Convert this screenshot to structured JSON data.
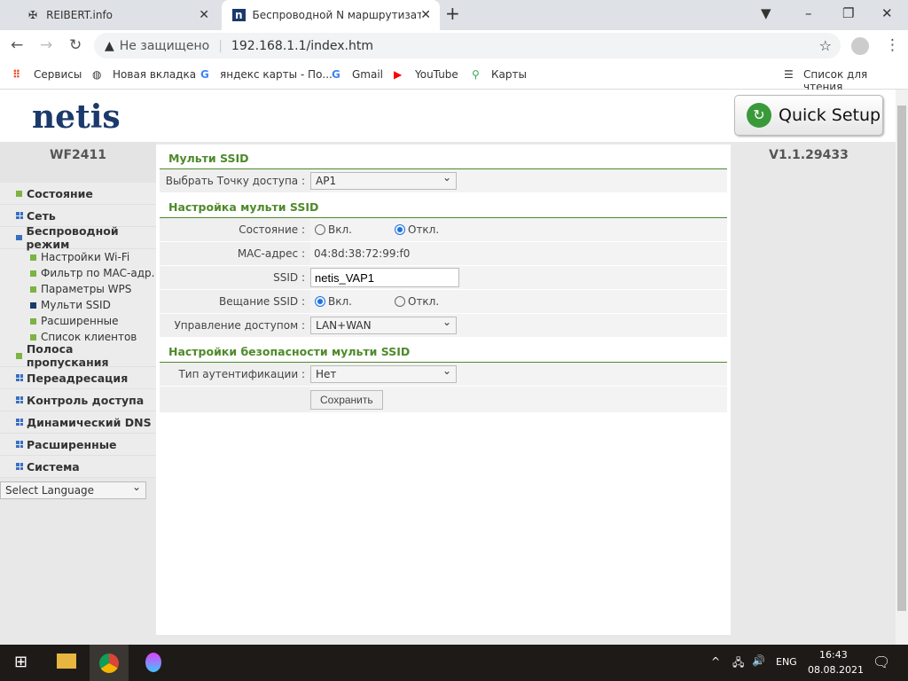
{
  "browser": {
    "tabs": [
      {
        "title": "REIBERT.info"
      },
      {
        "title": "Беспроводной N маршрутизато"
      }
    ],
    "security": "Не защищено",
    "url": "192.168.1.1/index.htm",
    "bookmarks": [
      "Сервисы",
      "Новая вкладка",
      "яндекс карты - По...",
      "Gmail",
      "YouTube",
      "Карты"
    ],
    "reading_list": "Список для чтения"
  },
  "header": {
    "logo": "netis",
    "quick_setup": "Quick Setup",
    "model": "WF2411",
    "version": "V1.1.29433"
  },
  "sidebar": {
    "items": [
      {
        "label": "Состояние"
      },
      {
        "label": "Сеть"
      },
      {
        "label": "Беспроводной режим"
      },
      {
        "label": "Полоса пропускания"
      },
      {
        "label": "Переадресация"
      },
      {
        "label": "Контроль доступа"
      },
      {
        "label": "Динамический DNS"
      },
      {
        "label": "Расширенные"
      },
      {
        "label": "Система"
      }
    ],
    "subitems": [
      "Настройки Wi-Fi",
      "Фильтр по MAC-адр.",
      "Параметры WPS",
      "Мульти SSID",
      "Расширенные",
      "Список клиентов"
    ],
    "language": "Select Language"
  },
  "main": {
    "sec1": "Мульти SSID",
    "ap_label": "Выбрать Точку доступа :",
    "ap_value": "AP1",
    "sec2": "Настройка мульти SSID",
    "state_label": "Состояние :",
    "on": "Вкл.",
    "off": "Откл.",
    "mac_label": "MAC-адрес :",
    "mac_value": "04:8d:38:72:99:f0",
    "ssid_label": "SSID :",
    "ssid_value": "netis_VAP1",
    "bcast_label": "Вещание SSID :",
    "access_label": "Управление доступом :",
    "access_value": "LAN+WAN",
    "sec3": "Настройки безопасности мульти SSID",
    "auth_label": "Тип аутентификации :",
    "auth_value": "Нет",
    "save": "Сохранить"
  },
  "taskbar": {
    "lang": "ENG",
    "time": "16:43",
    "date": "08.08.2021"
  }
}
